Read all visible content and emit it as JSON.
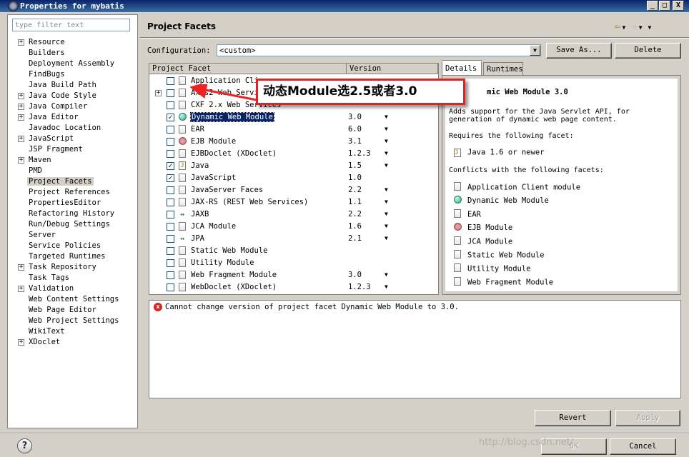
{
  "window": {
    "title": "Properties for mybatis",
    "minimize": "_",
    "maximize": "□",
    "close": "X"
  },
  "filter": {
    "placeholder": "type filter text",
    "value": ""
  },
  "nav": {
    "items": [
      {
        "label": "Resource",
        "expandable": true
      },
      {
        "label": "Builders",
        "expandable": false
      },
      {
        "label": "Deployment Assembly",
        "expandable": false
      },
      {
        "label": "FindBugs",
        "expandable": false
      },
      {
        "label": "Java Build Path",
        "expandable": false
      },
      {
        "label": "Java Code Style",
        "expandable": true
      },
      {
        "label": "Java Compiler",
        "expandable": true
      },
      {
        "label": "Java Editor",
        "expandable": true
      },
      {
        "label": "Javadoc Location",
        "expandable": false
      },
      {
        "label": "JavaScript",
        "expandable": true
      },
      {
        "label": "JSP Fragment",
        "expandable": false
      },
      {
        "label": "Maven",
        "expandable": true
      },
      {
        "label": "PMD",
        "expandable": false
      },
      {
        "label": "Project Facets",
        "expandable": false,
        "selected": true
      },
      {
        "label": "Project References",
        "expandable": false
      },
      {
        "label": "PropertiesEditor",
        "expandable": false
      },
      {
        "label": "Refactoring History",
        "expandable": false
      },
      {
        "label": "Run/Debug Settings",
        "expandable": false
      },
      {
        "label": "Server",
        "expandable": false
      },
      {
        "label": "Service Policies",
        "expandable": false
      },
      {
        "label": "Targeted Runtimes",
        "expandable": false
      },
      {
        "label": "Task Repository",
        "expandable": true
      },
      {
        "label": "Task Tags",
        "expandable": false
      },
      {
        "label": "Validation",
        "expandable": true
      },
      {
        "label": "Web Content Settings",
        "expandable": false
      },
      {
        "label": "Web Page Editor",
        "expandable": false
      },
      {
        "label": "Web Project Settings",
        "expandable": false
      },
      {
        "label": "WikiText",
        "expandable": false
      },
      {
        "label": "XDoclet",
        "expandable": true
      }
    ]
  },
  "page": {
    "title": "Project Facets",
    "config_label": "Configuration:",
    "config_value": "<custom>",
    "save_as": "Save As...",
    "delete": "Delete"
  },
  "facets": {
    "header_name": "Project Facet",
    "header_version": "Version",
    "rows": [
      {
        "name": "Application Cli",
        "version": "",
        "checked": false,
        "expandable": false,
        "icon": "page-icon",
        "dropdown": false
      },
      {
        "name": "Axis2 Web Servi",
        "version": "",
        "checked": false,
        "expandable": true,
        "icon": "page-icon",
        "dropdown": false
      },
      {
        "name": "CXF 2.x Web Services",
        "version": "",
        "checked": false,
        "expandable": false,
        "icon": "page-icon",
        "dropdown": false
      },
      {
        "name": "Dynamic Web Module",
        "version": "3.0",
        "checked": true,
        "expandable": false,
        "icon": "globe-icon",
        "dropdown": true,
        "selected": true
      },
      {
        "name": "EAR",
        "version": "6.0",
        "checked": false,
        "expandable": false,
        "icon": "page-icon",
        "dropdown": true
      },
      {
        "name": "EJB Module",
        "version": "3.1",
        "checked": false,
        "expandable": false,
        "icon": "bean-icon",
        "dropdown": true
      },
      {
        "name": "EJBDoclet (XDoclet)",
        "version": "1.2.3",
        "checked": false,
        "expandable": false,
        "icon": "page-icon",
        "dropdown": true
      },
      {
        "name": "Java",
        "version": "1.5",
        "checked": true,
        "expandable": false,
        "icon": "jar-icon",
        "dropdown": true
      },
      {
        "name": "JavaScript",
        "version": "1.0",
        "checked": true,
        "expandable": false,
        "icon": "page-icon",
        "dropdown": false
      },
      {
        "name": "JavaServer Faces",
        "version": "2.2",
        "checked": false,
        "expandable": false,
        "icon": "page-icon",
        "dropdown": true
      },
      {
        "name": "JAX-RS (REST Web Services)",
        "version": "1.1",
        "checked": false,
        "expandable": false,
        "icon": "page-icon",
        "dropdown": true
      },
      {
        "name": "JAXB",
        "version": "2.2",
        "checked": false,
        "expandable": false,
        "icon": "arrows-icon",
        "dropdown": true
      },
      {
        "name": "JCA Module",
        "version": "1.6",
        "checked": false,
        "expandable": false,
        "icon": "page-icon",
        "dropdown": true
      },
      {
        "name": "JPA",
        "version": "2.1",
        "checked": false,
        "expandable": false,
        "icon": "arrows-icon",
        "dropdown": true
      },
      {
        "name": "Static Web Module",
        "version": "",
        "checked": false,
        "expandable": false,
        "icon": "page-icon",
        "dropdown": false
      },
      {
        "name": "Utility Module",
        "version": "",
        "checked": false,
        "expandable": false,
        "icon": "page-icon",
        "dropdown": false
      },
      {
        "name": "Web Fragment Module",
        "version": "3.0",
        "checked": false,
        "expandable": false,
        "icon": "page-icon",
        "dropdown": true
      },
      {
        "name": "WebDoclet (XDoclet)",
        "version": "1.2.3",
        "checked": false,
        "expandable": false,
        "icon": "page-icon",
        "dropdown": true
      }
    ]
  },
  "details": {
    "tab_details": "Details",
    "tab_runtimes": "Runtimes",
    "title": "mic Web Module 3.0",
    "desc_line1": "Adds support for the Java Servlet API, for",
    "desc_line2": "generation of dynamic web page content.",
    "requires_label": "Requires the following facet:",
    "requires": [
      {
        "label": "Java 1.6 or newer",
        "icon": "jar-icon"
      }
    ],
    "conflicts_label": "Conflicts with the following facets:",
    "conflicts": [
      {
        "label": "Application Client module",
        "icon": "page-icon"
      },
      {
        "label": "Dynamic Web Module",
        "icon": "globe-icon"
      },
      {
        "label": "EAR",
        "icon": "page-icon"
      },
      {
        "label": "EJB Module",
        "icon": "bean-icon"
      },
      {
        "label": "JCA Module",
        "icon": "page-icon"
      },
      {
        "label": "Static Web Module",
        "icon": "page-icon"
      },
      {
        "label": "Utility Module",
        "icon": "page-icon"
      },
      {
        "label": "Web Fragment Module",
        "icon": "page-icon"
      }
    ]
  },
  "problems": {
    "message": "Cannot change version of project facet Dynamic Web Module to 3.0."
  },
  "buttons": {
    "revert": "Revert",
    "apply": "Apply",
    "ok": "OK",
    "cancel": "Cancel",
    "help": "?"
  },
  "annotation": {
    "text": "动态Module选2.5或者3.0",
    "color": "#e22222"
  },
  "watermark": "http://blog.csdn.net/"
}
